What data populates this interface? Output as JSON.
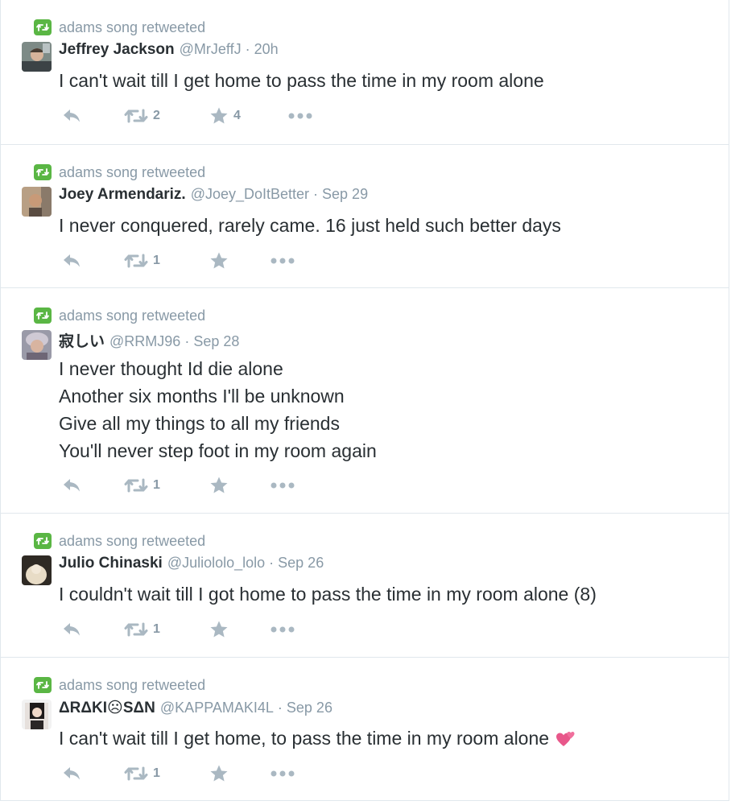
{
  "colors": {
    "accent_green": "#5ab644",
    "muted": "#8899a6",
    "text": "#292f33",
    "icon": "#aab8c2"
  },
  "tweets": [
    {
      "context": "adams song retweeted",
      "fullname": "Jeffrey Jackson",
      "username": "@MrJeffJ",
      "separator": "·",
      "time": "20h",
      "lines": [
        "I can't wait till I get home to pass the time in my room alone"
      ],
      "retweets": "2",
      "favorites": "4"
    },
    {
      "context": "adams song retweeted",
      "fullname": "Joey Armendariz.",
      "username": "@Joey_DoItBetter",
      "separator": "·",
      "time": "Sep 29",
      "lines": [
        "I never conquered, rarely came. 16 just held such better days"
      ],
      "retweets": "1",
      "favorites": ""
    },
    {
      "context": "adams song retweeted",
      "fullname": "寂しい",
      "username": "@RRMJ96",
      "separator": "·",
      "time": "Sep 28",
      "lines": [
        "I never thought Id die alone",
        "Another six months I'll be unknown",
        "Give all my things to all my friends",
        "You'll never step foot in my room again"
      ],
      "retweets": "1",
      "favorites": ""
    },
    {
      "context": "adams song retweeted",
      "fullname": "Julio Chinaski",
      "username": "@Juliololo_lolo",
      "separator": "·",
      "time": "Sep 26",
      "lines": [
        "I couldn't wait till I got home to pass the time in my room alone (8)"
      ],
      "retweets": "1",
      "favorites": ""
    },
    {
      "context": "adams song retweeted",
      "fullname": "ΔRΔKI☹SΔN",
      "username": "@KAPPAMAKI4L",
      "separator": "·",
      "time": "Sep 26",
      "lines": [
        "I can't wait till I get home, to pass the time in my room alone"
      ],
      "retweets": "1",
      "favorites": ""
    }
  ]
}
